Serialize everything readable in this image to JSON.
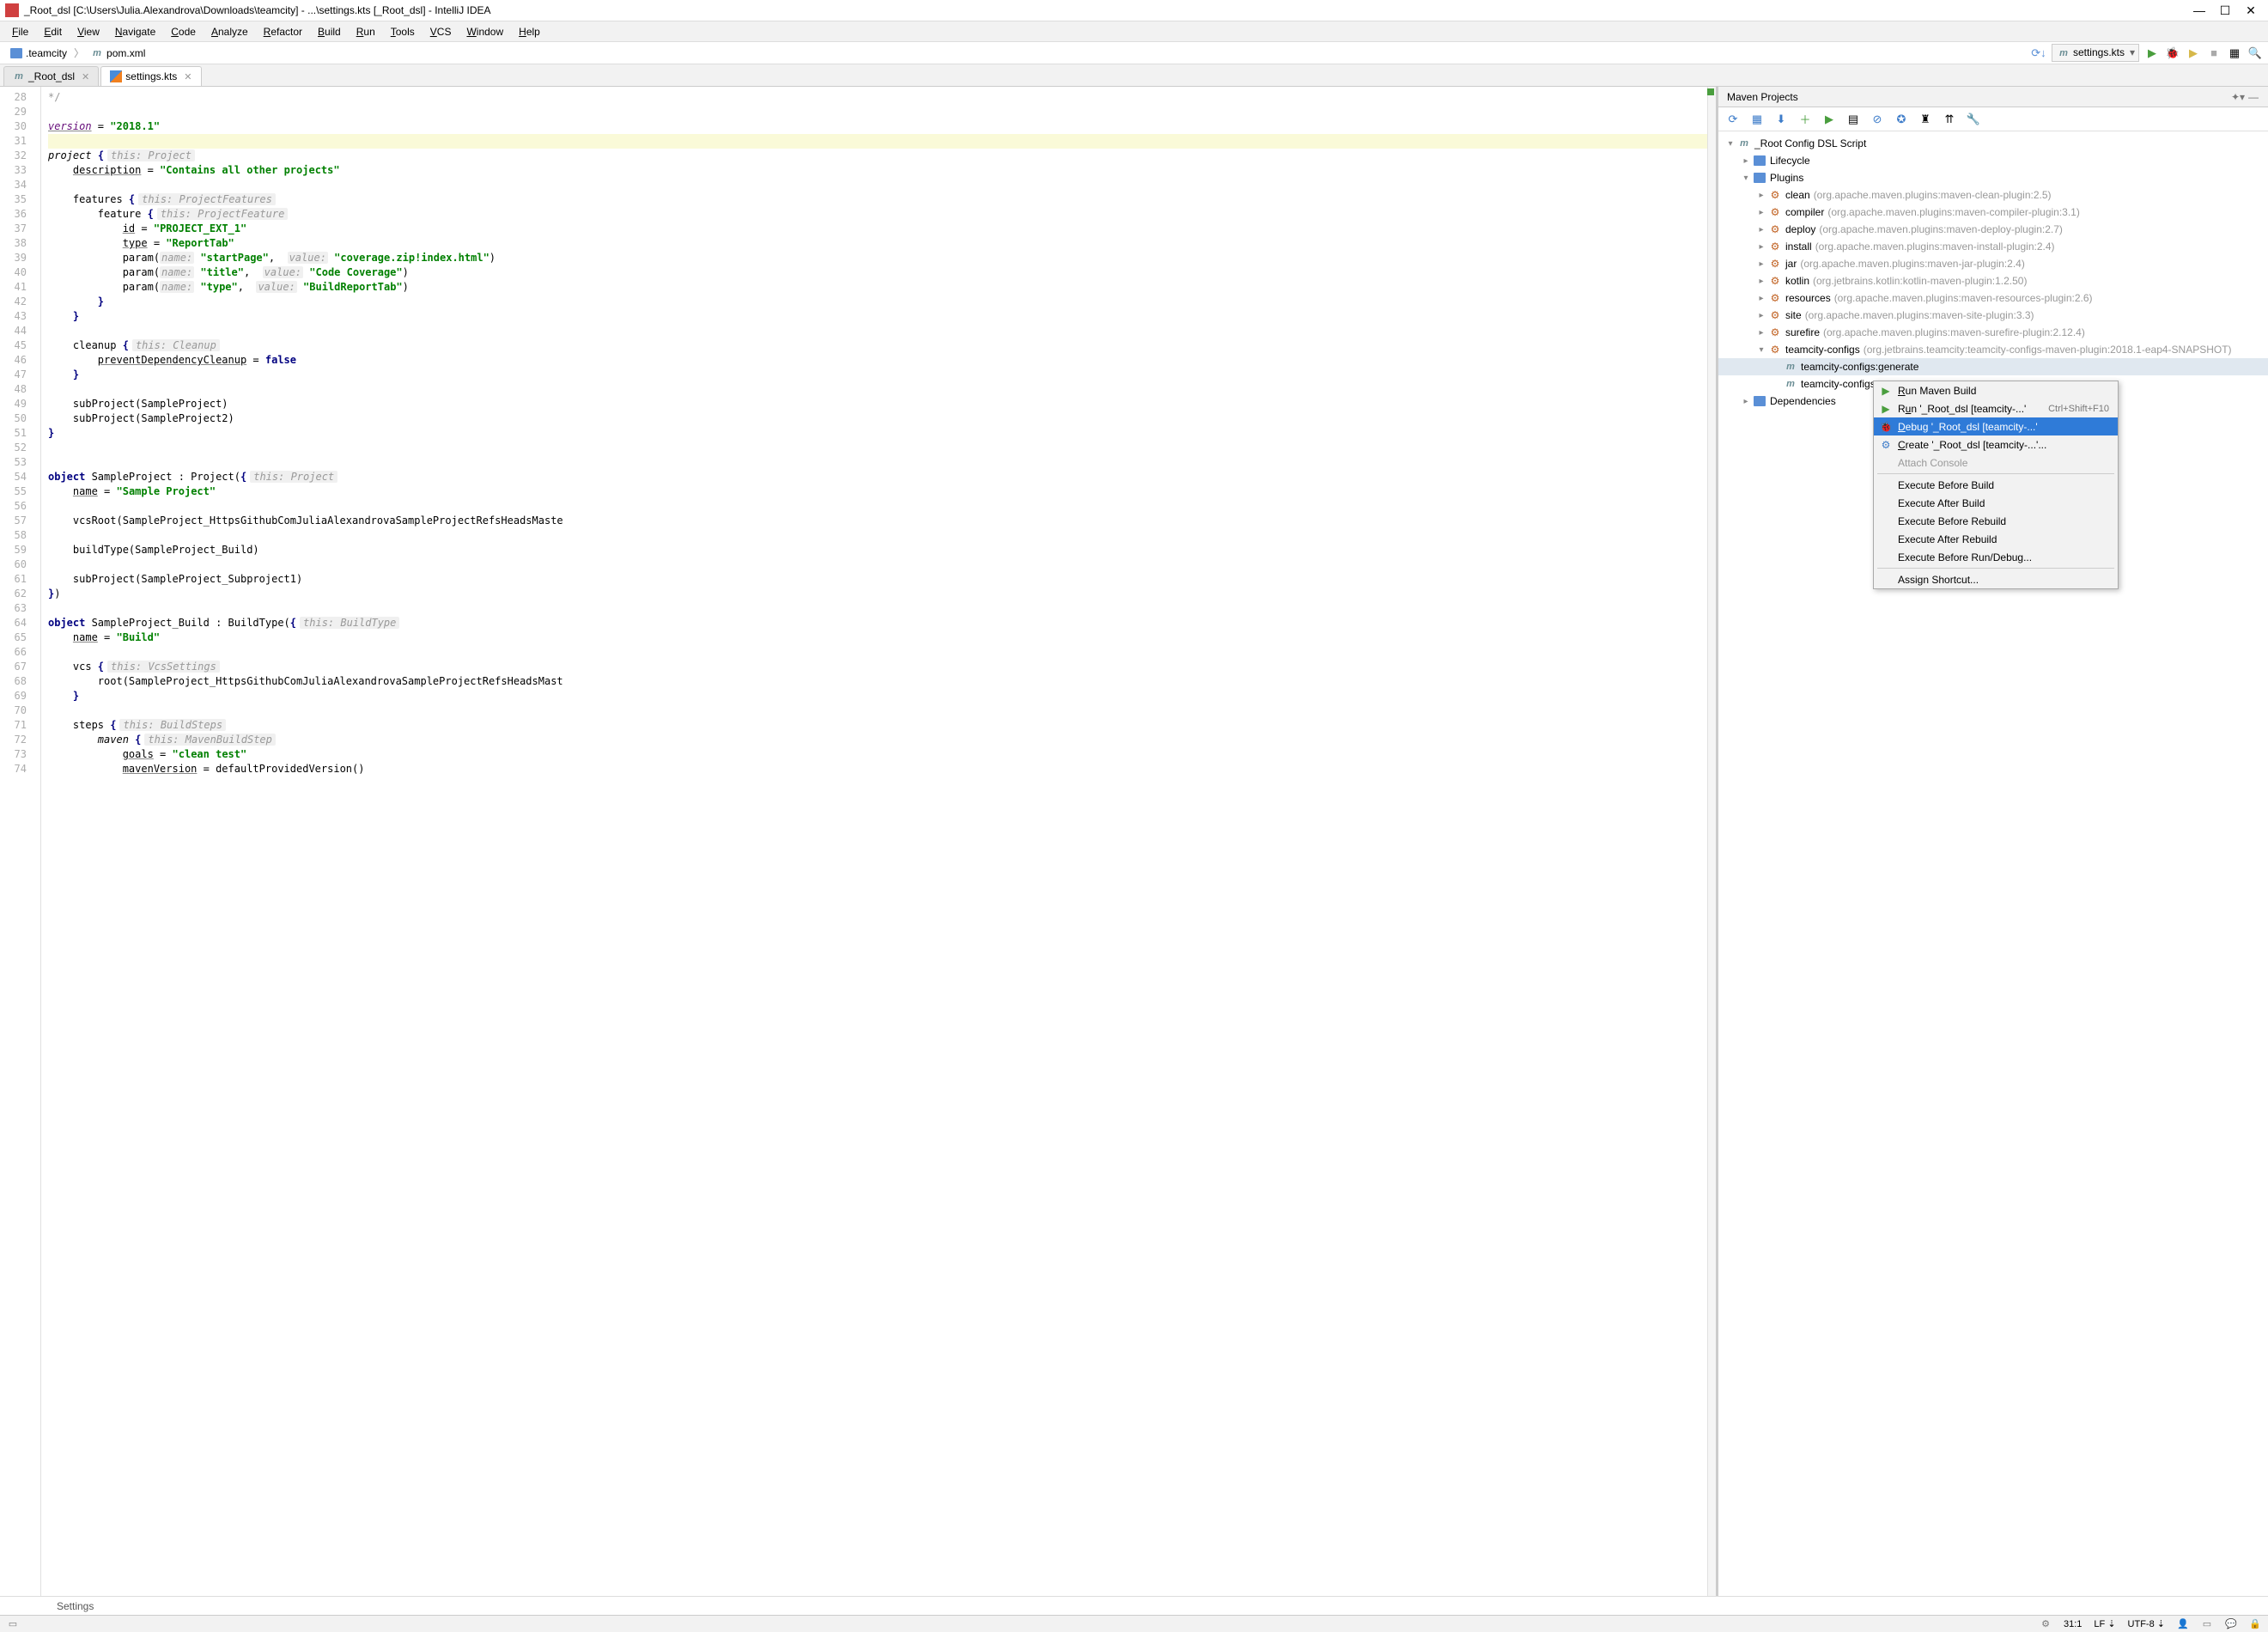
{
  "title": "_Root_dsl [C:\\Users\\Julia.Alexandrova\\Downloads\\teamcity] - ...\\settings.kts [_Root_dsl] - IntelliJ IDEA",
  "menus": [
    "File",
    "Edit",
    "View",
    "Navigate",
    "Code",
    "Analyze",
    "Refactor",
    "Build",
    "Run",
    "Tools",
    "VCS",
    "Window",
    "Help"
  ],
  "breadcrumb": {
    "folder": ".teamcity",
    "file": "pom.xml"
  },
  "run_config": "settings.kts",
  "tabs": [
    {
      "name": "_Root_dsl",
      "type": "module",
      "close": true,
      "active": false
    },
    {
      "name": "settings.kts",
      "type": "kotlin",
      "close": true,
      "active": true
    }
  ],
  "gutter_start": 28,
  "gutter_end": 74,
  "code_lines": [
    {
      "n": 28,
      "html": "<span style='color:#999'>*/</span>"
    },
    {
      "n": 29,
      "html": ""
    },
    {
      "n": 30,
      "html": "<span class='fn-u' style='font-style:italic;color:#660e7a'>version</span> = <span class='str'>\"2018.1\"</span>"
    },
    {
      "n": 31,
      "html": "",
      "hl": true
    },
    {
      "n": 32,
      "html": "<span style='font-style:italic'>project</span> <span class='kw'>{</span><span class='hint'>this: Project</span>"
    },
    {
      "n": 33,
      "html": "    <span class='fn-u'>description</span> = <span class='str'>\"Contains all other projects\"</span>"
    },
    {
      "n": 34,
      "html": ""
    },
    {
      "n": 35,
      "html": "    features <span class='kw'>{</span><span class='hint'>this: ProjectFeatures</span>"
    },
    {
      "n": 36,
      "html": "        feature <span class='kw'>{</span><span class='hint'>this: ProjectFeature</span>"
    },
    {
      "n": 37,
      "html": "            <span class='fn-u'>id</span> = <span class='str'>\"PROJECT_EXT_1\"</span>"
    },
    {
      "n": 38,
      "html": "            <span class='fn-u'>type</span> = <span class='str'>\"ReportTab\"</span>"
    },
    {
      "n": 39,
      "html": "            param(<span class='param-name'>name:</span> <span class='str'>\"startPage\"</span>,  <span class='param-name'>value:</span> <span class='str'>\"coverage.zip!index.html\"</span>)"
    },
    {
      "n": 40,
      "html": "            param(<span class='param-name'>name:</span> <span class='str'>\"title\"</span>,  <span class='param-name'>value:</span> <span class='str'>\"Code Coverage\"</span>)"
    },
    {
      "n": 41,
      "html": "            param(<span class='param-name'>name:</span> <span class='str'>\"type\"</span>,  <span class='param-name'>value:</span> <span class='str'>\"BuildReportTab\"</span>)"
    },
    {
      "n": 42,
      "html": "        <span class='kw'>}</span>"
    },
    {
      "n": 43,
      "html": "    <span class='kw'>}</span>"
    },
    {
      "n": 44,
      "html": ""
    },
    {
      "n": 45,
      "html": "    cleanup <span class='kw'>{</span><span class='hint'>this: Cleanup</span>"
    },
    {
      "n": 46,
      "html": "        <span class='fn-u'>preventDependencyCleanup</span> = <span class='kw'>false</span>"
    },
    {
      "n": 47,
      "html": "    <span class='kw'>}</span>"
    },
    {
      "n": 48,
      "html": ""
    },
    {
      "n": 49,
      "html": "    subProject(SampleProject)"
    },
    {
      "n": 50,
      "html": "    subProject(SampleProject2)"
    },
    {
      "n": 51,
      "html": "<span class='kw'>}</span>"
    },
    {
      "n": 52,
      "html": ""
    },
    {
      "n": 53,
      "html": ""
    },
    {
      "n": 54,
      "html": "<span class='kw'>object</span> SampleProject : Project(<span class='kw'>{</span><span class='hint'>this: Project</span>"
    },
    {
      "n": 55,
      "html": "    <span class='fn-u'>name</span> = <span class='str'>\"Sample Project\"</span>"
    },
    {
      "n": 56,
      "html": ""
    },
    {
      "n": 57,
      "html": "    vcsRoot(SampleProject_HttpsGithubComJuliaAlexandrovaSampleProjectRefsHeadsMaste"
    },
    {
      "n": 58,
      "html": ""
    },
    {
      "n": 59,
      "html": "    buildType(SampleProject_Build)"
    },
    {
      "n": 60,
      "html": ""
    },
    {
      "n": 61,
      "html": "    subProject(SampleProject_Subproject1)"
    },
    {
      "n": 62,
      "html": "<span class='kw'>}</span>)"
    },
    {
      "n": 63,
      "html": ""
    },
    {
      "n": 64,
      "html": "<span class='kw'>object</span> SampleProject_Build : BuildType(<span class='kw'>{</span><span class='hint'>this: BuildType</span>"
    },
    {
      "n": 65,
      "html": "    <span class='fn-u'>name</span> = <span class='str'>\"Build\"</span>"
    },
    {
      "n": 66,
      "html": ""
    },
    {
      "n": 67,
      "html": "    vcs <span class='kw'>{</span><span class='hint'>this: VcsSettings</span>"
    },
    {
      "n": 68,
      "html": "        root(SampleProject_HttpsGithubComJuliaAlexandrovaSampleProjectRefsHeadsMast"
    },
    {
      "n": 69,
      "html": "    <span class='kw'>}</span>"
    },
    {
      "n": 70,
      "html": ""
    },
    {
      "n": 71,
      "html": "    steps <span class='kw'>{</span><span class='hint'>this: BuildSteps</span>"
    },
    {
      "n": 72,
      "html": "        <span style='font-style:italic'>maven</span> <span class='kw'>{</span><span class='hint'>this: MavenBuildStep</span>"
    },
    {
      "n": 73,
      "html": "            <span class='fn-u'>goals</span> = <span class='str'>\"clean test\"</span>"
    },
    {
      "n": 74,
      "html": "            <span class='fn-u'>mavenVersion</span> = defaultProvidedVersion()"
    }
  ],
  "breadcrumb_bottom": "Settings",
  "maven": {
    "title": "Maven Projects",
    "root": "_Root Config DSL Script",
    "lifecycle": "Lifecycle",
    "plugins_label": "Plugins",
    "plugins": [
      {
        "name": "clean",
        "detail": "(org.apache.maven.plugins:maven-clean-plugin:2.5)"
      },
      {
        "name": "compiler",
        "detail": "(org.apache.maven.plugins:maven-compiler-plugin:3.1)"
      },
      {
        "name": "deploy",
        "detail": "(org.apache.maven.plugins:maven-deploy-plugin:2.7)"
      },
      {
        "name": "install",
        "detail": "(org.apache.maven.plugins:maven-install-plugin:2.4)"
      },
      {
        "name": "jar",
        "detail": "(org.apache.maven.plugins:maven-jar-plugin:2.4)"
      },
      {
        "name": "kotlin",
        "detail": "(org.jetbrains.kotlin:kotlin-maven-plugin:1.2.50)"
      },
      {
        "name": "resources",
        "detail": "(org.apache.maven.plugins:maven-resources-plugin:2.6)"
      },
      {
        "name": "site",
        "detail": "(org.apache.maven.plugins:maven-site-plugin:3.3)"
      },
      {
        "name": "surefire",
        "detail": "(org.apache.maven.plugins:maven-surefire-plugin:2.12.4)"
      },
      {
        "name": "teamcity-configs",
        "detail": "(org.jetbrains.teamcity:teamcity-configs-maven-plugin:2018.1-eap4-SNAPSHOT)",
        "expanded": true
      }
    ],
    "goals": [
      {
        "name": "teamcity-configs:generate",
        "sel": true
      },
      {
        "name": "teamcity-configs"
      }
    ],
    "dependencies": "Dependencies"
  },
  "ctx": {
    "items": [
      {
        "label": "Run Maven Build",
        "icon": "run",
        "u": "R"
      },
      {
        "label": "Run '_Root_dsl [teamcity-...'",
        "icon": "run",
        "kbd": "Ctrl+Shift+F10",
        "u": "u"
      },
      {
        "label": "Debug '_Root_dsl [teamcity-...'",
        "icon": "debug",
        "selected": true,
        "u": "D"
      },
      {
        "label": "Create '_Root_dsl [teamcity-...'...",
        "icon": "gear",
        "u": "C"
      },
      {
        "label": "Attach Console",
        "disabled": true
      },
      {
        "sep": true
      },
      {
        "label": "Execute Before Build"
      },
      {
        "label": "Execute After Build"
      },
      {
        "label": "Execute Before Rebuild"
      },
      {
        "label": "Execute After Rebuild"
      },
      {
        "label": "Execute Before Run/Debug..."
      },
      {
        "sep": true
      },
      {
        "label": "Assign Shortcut..."
      }
    ]
  },
  "status": {
    "pos": "31:1",
    "le": "LF",
    "enc": "UTF-8",
    "insp": "⇆"
  }
}
